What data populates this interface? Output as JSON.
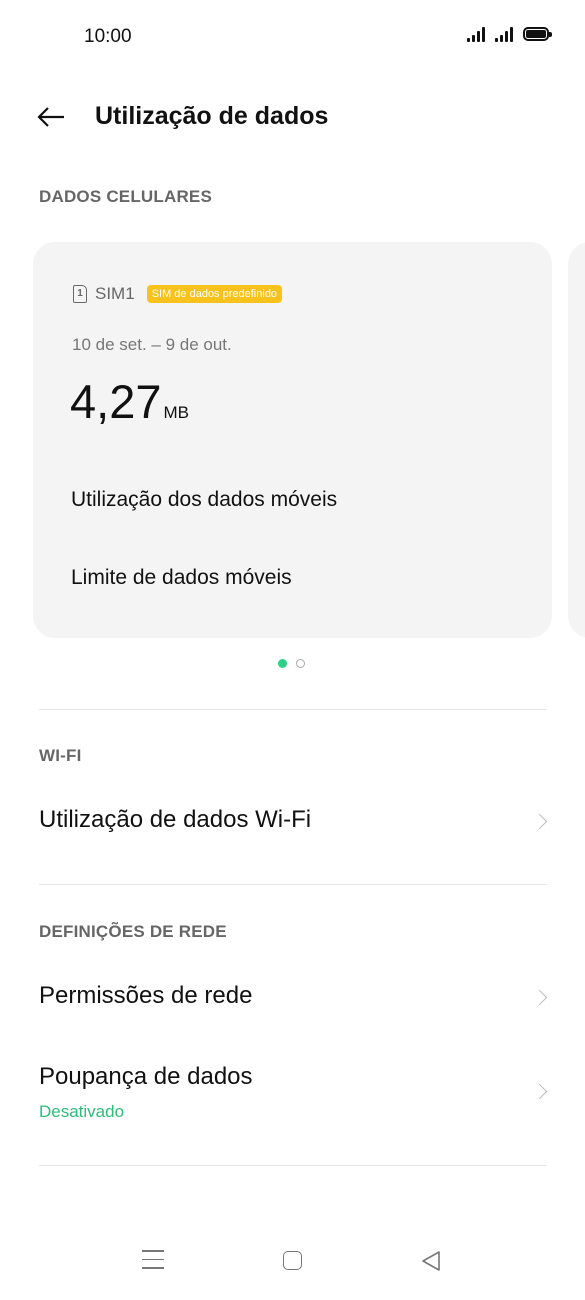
{
  "status_bar": {
    "time": "10:00"
  },
  "header": {
    "title": "Utilização de dados",
    "back_icon": "arrow-left-icon"
  },
  "sections": {
    "cellular_label": "DADOS CELULARES",
    "wifi_label": "WI-FI",
    "network_label": "DEFINIÇÕES DE REDE"
  },
  "sim_card": {
    "sim_number": "1",
    "sim_label": "SIM1",
    "badge": "SIM de dados predefinido",
    "period": "10 de set. – 9 de out.",
    "usage_value": "4,27",
    "usage_unit": "MB",
    "link_usage": "Utilização dos dados móveis",
    "link_limit": "Limite de dados móveis"
  },
  "pager": {
    "total": 2,
    "active_index": 0
  },
  "wifi": {
    "usage_label": "Utilização de dados Wi-Fi"
  },
  "network": {
    "permissions_label": "Permissões de rede",
    "data_saver_label": "Poupança de dados",
    "data_saver_status": "Desativado"
  },
  "colors": {
    "accent_green": "#2ecf87",
    "badge_yellow": "#f8c21c"
  },
  "nav_bar": {
    "items": [
      "menu-icon",
      "home-icon",
      "back-triangle-icon"
    ]
  }
}
